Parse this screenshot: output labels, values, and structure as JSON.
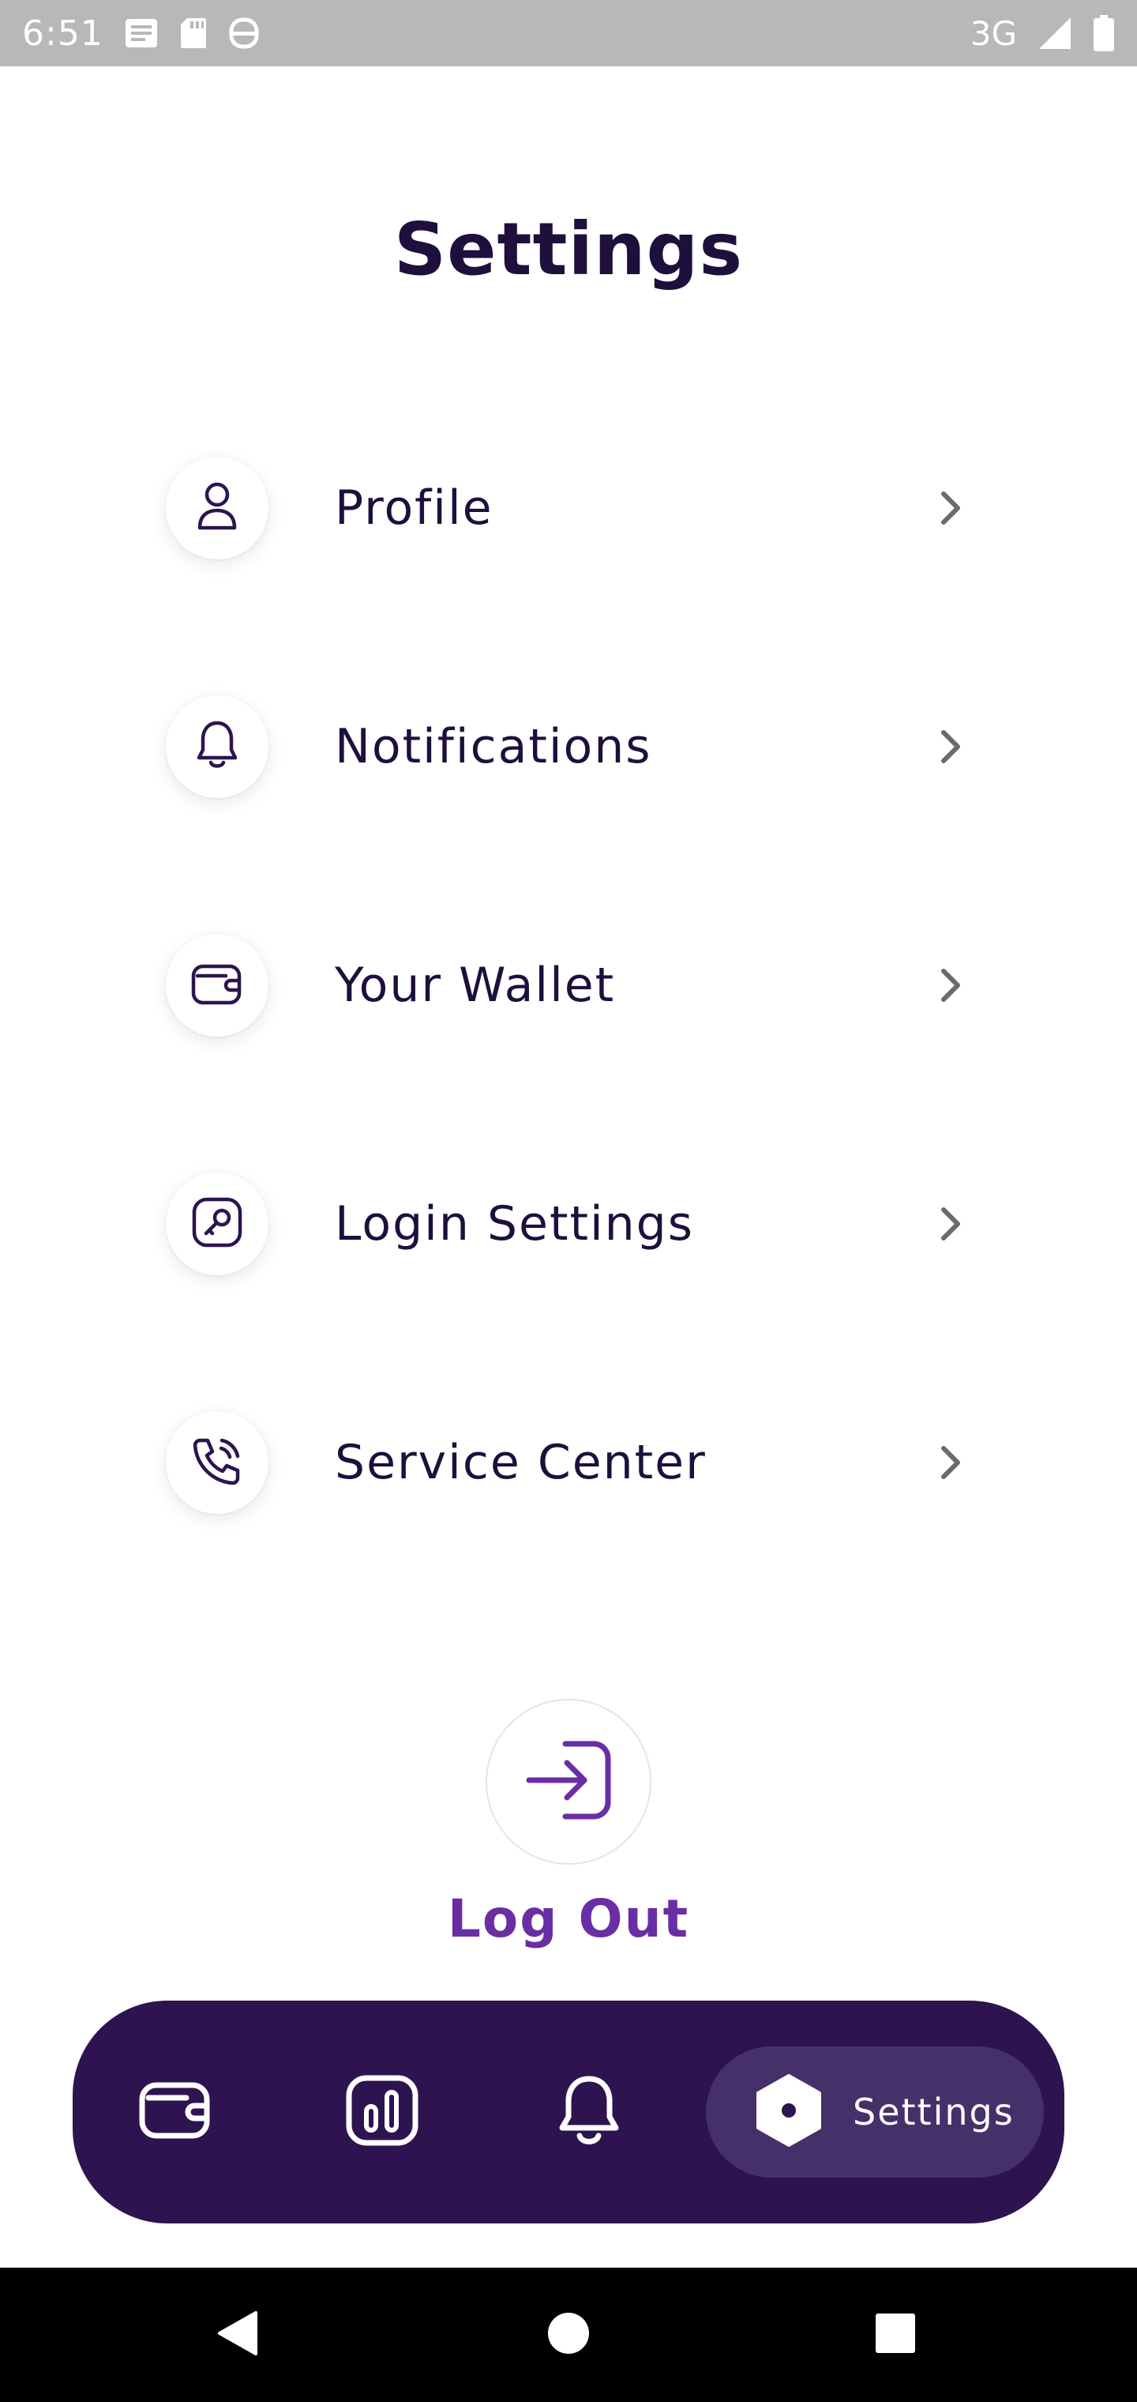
{
  "status_bar": {
    "time": "6:51",
    "network": "3G",
    "icons": [
      "notification-icon",
      "sd-card-icon",
      "sync-icon",
      "signal-icon",
      "battery-icon"
    ]
  },
  "page": {
    "title": "Settings"
  },
  "menu": {
    "items": [
      {
        "label": "Profile",
        "icon": "person-icon"
      },
      {
        "label": "Notifications",
        "icon": "bell-icon"
      },
      {
        "label": "Your Wallet",
        "icon": "wallet-icon"
      },
      {
        "label": "Login Settings",
        "icon": "key-icon"
      },
      {
        "label": "Service Center",
        "icon": "phone-icon"
      }
    ]
  },
  "logout": {
    "label": "Log Out",
    "icon": "login-arrow-icon"
  },
  "bottom_nav": {
    "items": [
      {
        "icon": "wallet-icon"
      },
      {
        "icon": "chart-icon"
      },
      {
        "icon": "bell-icon"
      },
      {
        "icon": "settings-hex-icon",
        "label": "Settings",
        "active": true
      }
    ]
  },
  "colors": {
    "primary_dark": "#2d1450",
    "title_text": "#1e0f3c",
    "accent_purple": "#6a2ea4",
    "nav_active_bg": "#45306a"
  }
}
